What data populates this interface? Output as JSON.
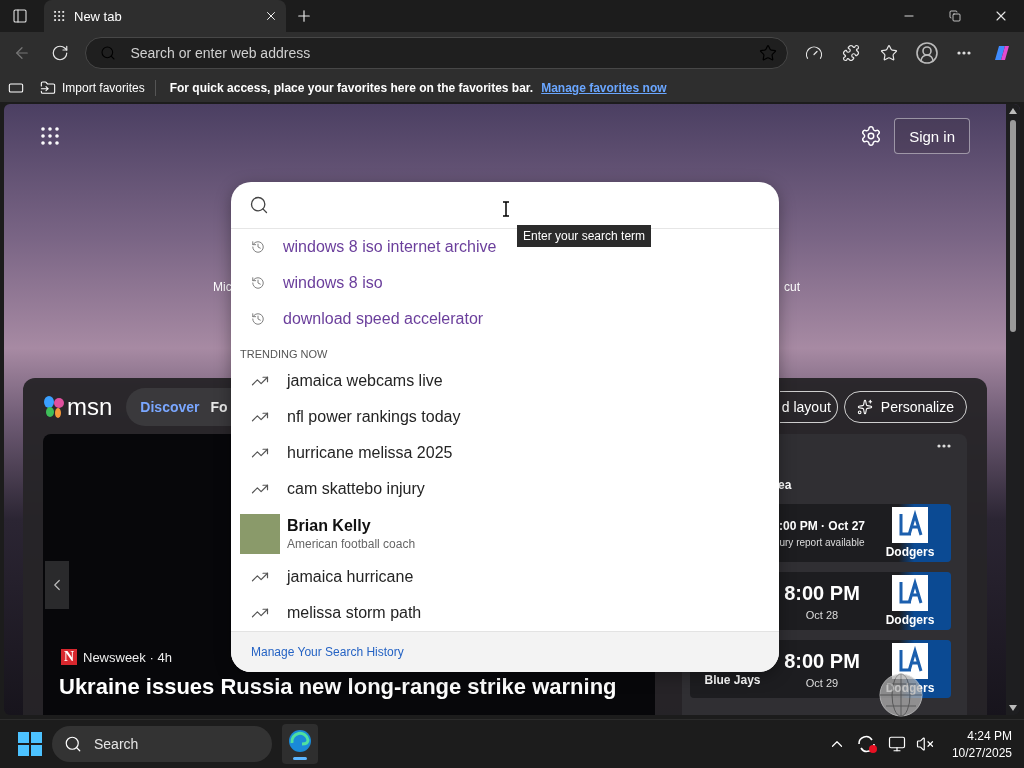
{
  "browser": {
    "tabs": [
      {
        "title": "New tab",
        "selected": true
      }
    ],
    "address_bar": {
      "placeholder": "Search or enter web address"
    }
  },
  "favorites_bar": {
    "import_label": "Import favorites",
    "message": "For quick access, place your favorites here on the favorites bar.",
    "link": "Manage favorites now"
  },
  "page": {
    "sign_in": "Sign in",
    "quick_links": [
      "Mic",
      "cut"
    ]
  },
  "msn": {
    "logo": "msn",
    "nav": [
      {
        "label": "Discover",
        "selected": true
      },
      {
        "label": "Fo",
        "selected": false
      }
    ],
    "buttons": [
      {
        "kind": "plain",
        "label": "d layout"
      },
      {
        "kind": "personalize",
        "label": "Personalize"
      }
    ],
    "hero": {
      "source_logo": "N",
      "source": "Newsweek · 4h",
      "headline": "Ukraine issues Russia new long-range strike warning"
    },
    "sports": {
      "title": "ea",
      "games": [
        {
          "kind": "soon",
          "time": ":00 PM · Oct 27",
          "detail": "ury report available",
          "home": "Dodgers"
        },
        {
          "kind": "scheduled",
          "time": "8:00 PM",
          "detail": "Oct 28",
          "home": "Dodgers"
        },
        {
          "kind": "scheduled",
          "time": "8:00 PM",
          "detail": "Oct 29",
          "away": "Blue Jays",
          "home": "Dodgers"
        }
      ]
    }
  },
  "search_dropdown": {
    "tooltip": "Enter your search term",
    "suggestions": [
      {
        "kind": "history",
        "text": "windows 8 iso internet archive"
      },
      {
        "kind": "history",
        "text": "windows 8 iso"
      },
      {
        "kind": "history",
        "text": "download speed accelerator"
      },
      {
        "kind": "heading",
        "text": "TRENDING NOW"
      },
      {
        "kind": "trending",
        "text": "jamaica webcams live"
      },
      {
        "kind": "trending",
        "text": "nfl power rankings today"
      },
      {
        "kind": "trending",
        "text": "hurricane melissa 2025"
      },
      {
        "kind": "trending",
        "text": "cam skattebo injury"
      },
      {
        "kind": "entity",
        "text": "Brian Kelly",
        "subtitle": "American football coach"
      },
      {
        "kind": "trending",
        "text": "jamaica hurricane"
      },
      {
        "kind": "trending",
        "text": "melissa storm path"
      }
    ],
    "footer_link": "Manage Your Search History"
  },
  "taskbar": {
    "search_placeholder": "Search",
    "time": "4:24 PM",
    "date": "10/27/2025"
  }
}
